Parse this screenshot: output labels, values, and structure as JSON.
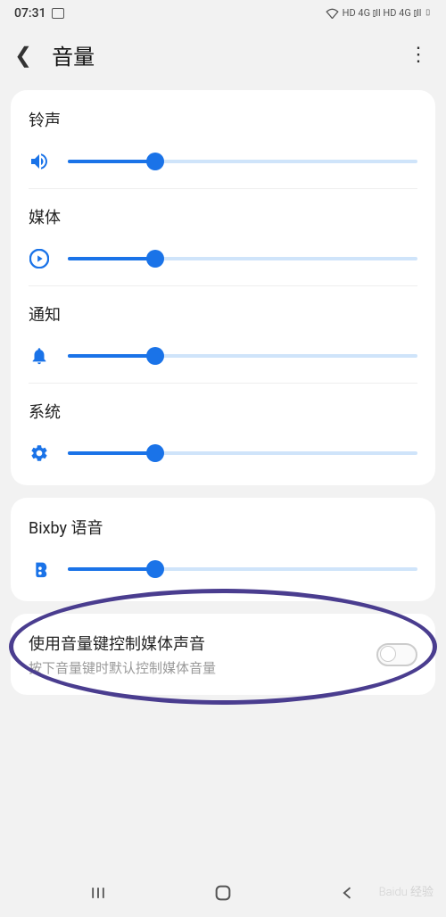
{
  "status": {
    "time": "07:31",
    "indicators": "HD 4G ⫾ll HD 4G ⫾ll ▯"
  },
  "header": {
    "title": "音量"
  },
  "sliders": {
    "ringtone": {
      "label": "铃声",
      "value": 25
    },
    "media": {
      "label": "媒体",
      "value": 25
    },
    "notification": {
      "label": "通知",
      "value": 25
    },
    "system": {
      "label": "系统",
      "value": 25
    },
    "bixby": {
      "label": "Bixby 语音",
      "value": 25
    }
  },
  "toggle": {
    "title": "使用音量键控制媒体声音",
    "description": "按下音量键时默认控制媒体音量",
    "enabled": false
  },
  "colors": {
    "accent": "#1a73e8",
    "annotation": "#4a3d8f"
  },
  "watermark": "Baidu 经验"
}
